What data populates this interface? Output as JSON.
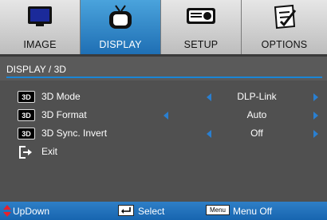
{
  "tabs": [
    {
      "label": "IMAGE",
      "icon": "monitor-icon",
      "active": false
    },
    {
      "label": "DISPLAY",
      "icon": "tv-icon",
      "active": true
    },
    {
      "label": "SETUP",
      "icon": "projector-icon",
      "active": false
    },
    {
      "label": "OPTIONS",
      "icon": "checklist-icon",
      "active": false
    }
  ],
  "breadcrumb": "DISPLAY / 3D",
  "items": [
    {
      "badge": "3D",
      "label": "3D Mode",
      "value": "DLP-Link"
    },
    {
      "badge": "3D",
      "label": "3D Format",
      "value": "Auto"
    },
    {
      "badge": "3D",
      "label": "3D Sync. Invert",
      "value": "Off"
    },
    {
      "label": "Exit",
      "icon": "exit-icon"
    }
  ],
  "footer": {
    "updown": "UpDown",
    "select": "Select",
    "menu_key": "Menu",
    "menu_off": "Menu Off"
  },
  "colors": {
    "accent": "#1f6fb4",
    "arrow": "#2a7fd0",
    "active_tab": "#4aa3dc"
  }
}
